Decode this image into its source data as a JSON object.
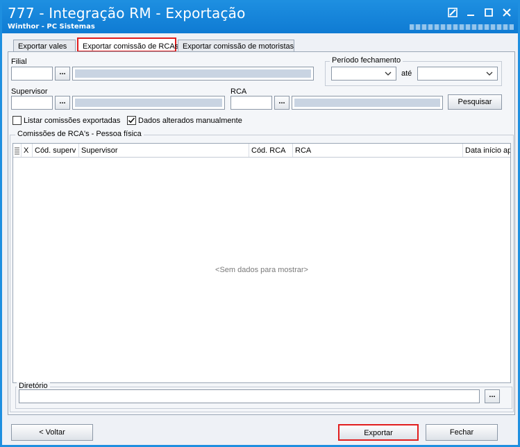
{
  "window": {
    "title": "777 - Integração RM - Exportação",
    "subtitle": "Winthor - PC Sistemas"
  },
  "tabs": [
    {
      "label": "Exportar vales"
    },
    {
      "label": "Exportar comissão de RCAs"
    },
    {
      "label": "Exportar comissão de motoristas"
    }
  ],
  "form": {
    "filial_label": "Filial",
    "periodo_label": "Período fechamento",
    "ate_label": "até",
    "supervisor_label": "Supervisor",
    "rca_label": "RCA",
    "dots_label": "...",
    "pesquisar_label": "Pesquisar",
    "listar_label": "Listar comissões exportadas",
    "dados_label": "Dados alterados manualmente",
    "listar_checked": false,
    "dados_checked": true
  },
  "grid": {
    "group_title": "Comissões de RCA's - Pessoa física",
    "columns": [
      "X",
      "Cód. superv",
      "Supervisor",
      "Cód. RCA",
      "RCA",
      "Data início apu"
    ],
    "empty_message": "<Sem dados para mostrar>"
  },
  "directory": {
    "label": "Diretório",
    "value": "",
    "dots_label": "..."
  },
  "footer": {
    "voltar_label": "< Voltar",
    "exportar_label": "Exportar",
    "fechar_label": "Fechar"
  },
  "colors": {
    "titlebar": "#0f7bd3",
    "highlight": "#e11d1d",
    "readonly_fill": "#c9d4e2"
  }
}
